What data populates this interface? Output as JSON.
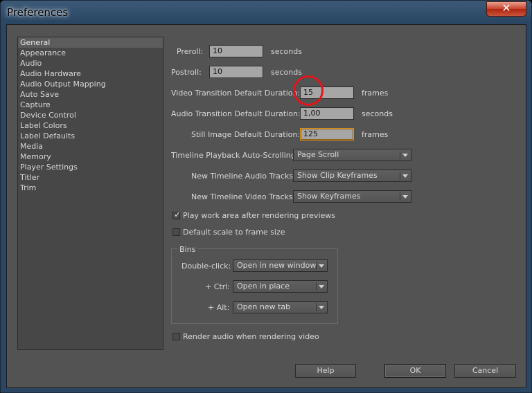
{
  "window": {
    "title": "Preferences",
    "close_glyph": "✕"
  },
  "sidebar": {
    "items": [
      {
        "label": "General",
        "selected": true
      },
      {
        "label": "Appearance"
      },
      {
        "label": "Audio"
      },
      {
        "label": "Audio Hardware"
      },
      {
        "label": "Audio Output Mapping"
      },
      {
        "label": "Auto Save"
      },
      {
        "label": "Capture"
      },
      {
        "label": "Device Control"
      },
      {
        "label": "Label Colors"
      },
      {
        "label": "Label Defaults"
      },
      {
        "label": "Media"
      },
      {
        "label": "Memory"
      },
      {
        "label": "Player Settings"
      },
      {
        "label": "Titler"
      },
      {
        "label": "Trim"
      }
    ]
  },
  "general": {
    "preroll": {
      "label": "Preroll:",
      "value": "10",
      "unit": "seconds"
    },
    "postroll": {
      "label": "Postroll:",
      "value": "10",
      "unit": "seconds"
    },
    "video_transition": {
      "label": "Video Transition Default Duration:",
      "value": "15",
      "unit": "frames"
    },
    "audio_transition": {
      "label": "Audio Transition Default Duration:",
      "value": "1,00",
      "unit": "seconds"
    },
    "still_image": {
      "label": "Still Image Default Duration:",
      "value": "125",
      "unit": "frames"
    },
    "timeline_autoscroll": {
      "label": "Timeline Playback Auto-Scrolling:",
      "value": "Page Scroll"
    },
    "audio_tracks": {
      "label": "New Timeline Audio Tracks:",
      "value": "Show Clip Keyframes"
    },
    "video_tracks": {
      "label": "New Timeline Video Tracks:",
      "value": "Show Keyframes"
    },
    "play_work_area": {
      "label": "Play work area after rendering previews",
      "checked": true
    },
    "default_scale": {
      "label": "Default scale to frame size",
      "checked": false
    },
    "bins": {
      "title": "Bins",
      "double_click": {
        "label": "Double-click:",
        "value": "Open in new window"
      },
      "ctrl": {
        "label": "+ Ctrl:",
        "value": "Open in place"
      },
      "alt": {
        "label": "+ Alt:",
        "value": "Open new tab"
      }
    },
    "render_audio": {
      "label": "Render audio when rendering video",
      "checked": false
    }
  },
  "buttons": {
    "help": "Help",
    "ok": "OK",
    "cancel": "Cancel"
  },
  "colors": {
    "highlight_circle": "#e3141b",
    "focus_border": "#e39a1f"
  },
  "check_glyph": "✓"
}
